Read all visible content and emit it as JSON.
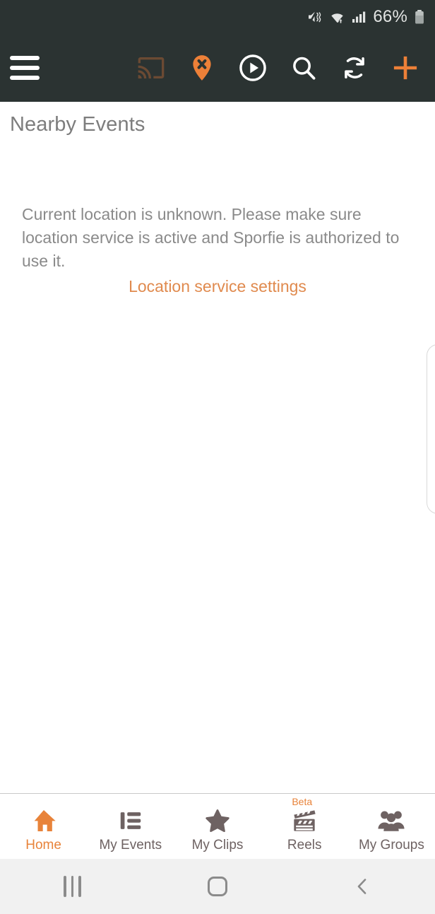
{
  "status_bar": {
    "battery_percent": "66%",
    "icons": [
      "mute-vibrate-icon",
      "wifi-transfer-icon",
      "cellular-signal-icon",
      "battery-icon"
    ]
  },
  "app_bar": {
    "background_color": "#2b3332",
    "accent_color": "#ed8038",
    "menu_icon": "hamburger-menu-icon",
    "actions": [
      {
        "name": "cast-icon",
        "label": "Cast",
        "state": "disabled",
        "color": "#6b4a33"
      },
      {
        "name": "location-off-pin-icon",
        "label": "Location unavailable",
        "state": "alert",
        "color": "#ed8038"
      },
      {
        "name": "play-circle-icon",
        "label": "Play",
        "state": "enabled",
        "color": "#ffffff"
      },
      {
        "name": "search-icon",
        "label": "Search",
        "state": "enabled",
        "color": "#ffffff"
      },
      {
        "name": "refresh-icon",
        "label": "Refresh",
        "state": "enabled",
        "color": "#ffffff"
      },
      {
        "name": "plus-icon",
        "label": "Add",
        "state": "enabled",
        "color": "#ed8038"
      }
    ]
  },
  "page": {
    "title": "Nearby Events",
    "message": "Current location is unknown. Please make sure location service is active and Sporfie is authorized to use it.",
    "link_label": "Location service settings",
    "link_color": "#e08a4e"
  },
  "bottom_nav": {
    "active_color": "#e8833a",
    "inactive_color": "#6e6262",
    "items": [
      {
        "label": "Home",
        "icon": "home-icon",
        "active": true,
        "badge": ""
      },
      {
        "label": "My Events",
        "icon": "list-icon",
        "active": false,
        "badge": ""
      },
      {
        "label": "My Clips",
        "icon": "star-icon",
        "active": false,
        "badge": ""
      },
      {
        "label": "Reels",
        "icon": "clapperboard-icon",
        "active": false,
        "badge": "Beta"
      },
      {
        "label": "My Groups",
        "icon": "people-icon",
        "active": false,
        "badge": ""
      }
    ]
  },
  "system_nav": {
    "buttons": [
      {
        "name": "recents-button",
        "icon": "recents-icon"
      },
      {
        "name": "home-button",
        "icon": "home-square-icon"
      },
      {
        "name": "back-button",
        "icon": "back-chevron-icon"
      }
    ]
  }
}
